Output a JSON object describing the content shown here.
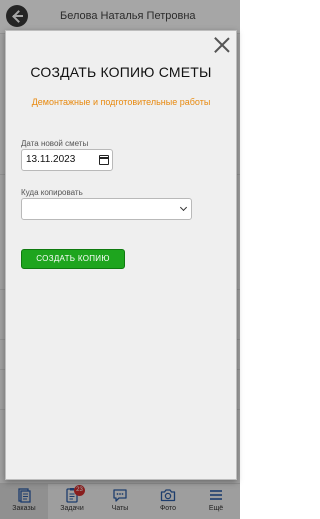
{
  "header": {
    "user_name": "Белова Наталья Петровна"
  },
  "modal": {
    "title": "СОЗДАТЬ КОПИЮ СМЕТЫ",
    "subtitle": "Демонтажные и подготовительные работы",
    "date_label": "Дата новой сметы",
    "date_value": "13.11.2023",
    "target_label": "Куда копировать",
    "target_value": "",
    "create_button": "СОЗДАТЬ КОПИЮ"
  },
  "bottom_nav": {
    "items": [
      {
        "label": "Заказы",
        "icon": "orders-icon",
        "active": true
      },
      {
        "label": "Задачи",
        "icon": "tasks-icon",
        "badge": "23"
      },
      {
        "label": "Чаты",
        "icon": "chat-icon"
      },
      {
        "label": "Фото",
        "icon": "camera-icon"
      },
      {
        "label": "Ещё",
        "icon": "menu-icon"
      }
    ]
  },
  "colors": {
    "accent_green": "#1ea51e",
    "subtitle_orange": "#e88a10",
    "nav_blue": "#2d5fa8",
    "badge_red": "#d32f2f"
  }
}
